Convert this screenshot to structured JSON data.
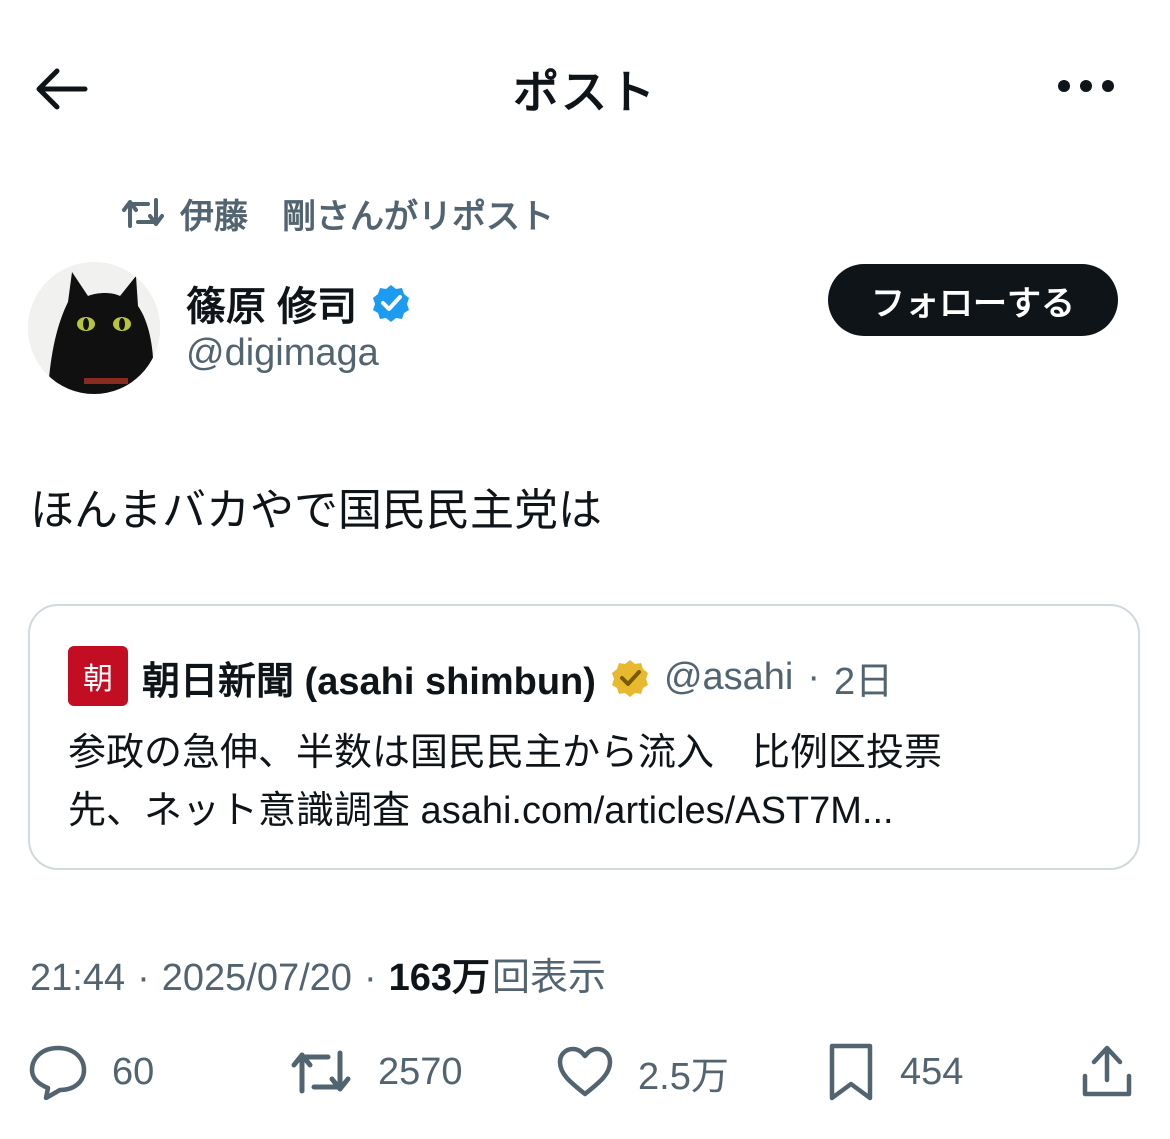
{
  "header": {
    "title": "ポスト",
    "back_icon": "arrow-left-icon",
    "more_icon": "more-horizontal-icon"
  },
  "repost": {
    "label": "伊藤　剛さんがリポスト",
    "icon": "repost-icon"
  },
  "author": {
    "name": "篠原 修司",
    "handle": "@digimaga",
    "verified": true,
    "verified_color": "#1d9bf0"
  },
  "follow_button": {
    "label": "フォローする"
  },
  "post": {
    "text": "ほんまバカやで国民民主党は"
  },
  "quote": {
    "logo_text": "朝",
    "name": "朝日新聞 (asahi shimbun)",
    "verified_color": "#e8b92f",
    "handle": "@asahi",
    "separator": "·",
    "time": "2日",
    "text_line1": "参政の急伸、半数は国民民主から流入　比例区投票",
    "text_line2": "先、ネット意識調査 asahi.com/articles/AST7M..."
  },
  "meta": {
    "time": "21:44",
    "sep": "·",
    "date": "2025/07/20",
    "views_count": "163万",
    "views_label": "回表示"
  },
  "actions": {
    "reply": "60",
    "retweet": "2570",
    "like": "2.5万",
    "bookmark": "454"
  },
  "colors": {
    "text": "#0f1419",
    "secondary": "#536471",
    "border": "#cfd9de",
    "accent": "#1d9bf0"
  }
}
